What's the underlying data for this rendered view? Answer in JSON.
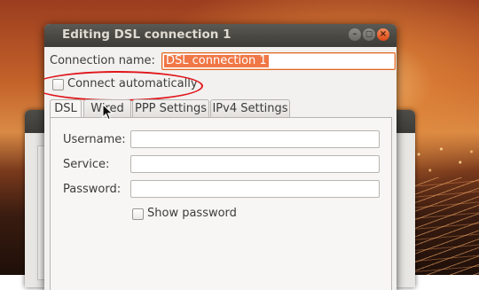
{
  "window": {
    "title": "Editing DSL connection 1",
    "minimize_symbol": "–",
    "maximize_symbol": "◻",
    "close_symbol": "×"
  },
  "connection": {
    "name_label": "Connection name:",
    "name_value": "DSL connection 1",
    "auto_label": "Connect automatically",
    "auto_checked": false
  },
  "tabs": [
    {
      "label": "DSL",
      "active": true
    },
    {
      "label": "Wired",
      "active": false
    },
    {
      "label": "PPP Settings",
      "active": false
    },
    {
      "label": "IPv4 Settings",
      "active": false
    }
  ],
  "dsl_form": {
    "username_label": "Username:",
    "username_value": "",
    "service_label": "Service:",
    "service_value": "",
    "password_label": "Password:",
    "password_value": "",
    "show_password_label": "Show password",
    "show_password_checked": false
  },
  "colors": {
    "accent": "#f07746",
    "highlight_ellipse": "#e0161b",
    "titlebar": "#3c3b37"
  },
  "icons": {
    "cursor": "arrow-cursor-icon"
  }
}
